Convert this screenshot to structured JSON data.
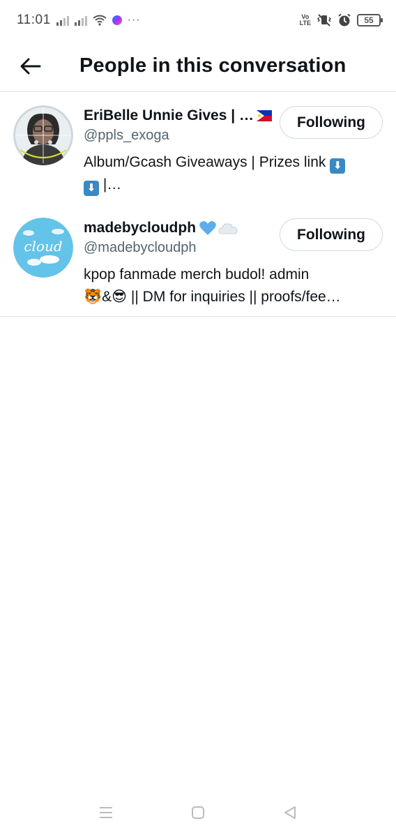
{
  "status_bar": {
    "time": "11:01",
    "volte_top": "Vo",
    "volte_bottom": "LTE",
    "battery": "55",
    "overflow": "···"
  },
  "header": {
    "title": "People in this conversation"
  },
  "users": [
    {
      "display_name": "EriBelle Unnie Gives | …",
      "name_emoji": "philippines-flag",
      "handle": "@ppls_exoga",
      "bio_line1": "Album/Gcash Giveaways | Prizes link",
      "bio_line2": "|…",
      "bio_emoji": "⬇",
      "follow_label": "Following"
    },
    {
      "display_name": "madebycloudph",
      "name_emoji": "blue-heart-and-cloud",
      "handle": "@madebycloudph",
      "bio_line1": "kpop fanmade merch budol! admin",
      "bio_line2": "|| DM for inquiries || proofs/fee…",
      "bio_emoji_a": "🐯",
      "bio_amp": "&",
      "bio_emoji_b": "😎",
      "follow_label": "Following"
    }
  ],
  "colors": {
    "text": "#0f1419",
    "secondary": "#536471",
    "divider": "#e1e6ea",
    "button_border": "#cfd9de"
  }
}
